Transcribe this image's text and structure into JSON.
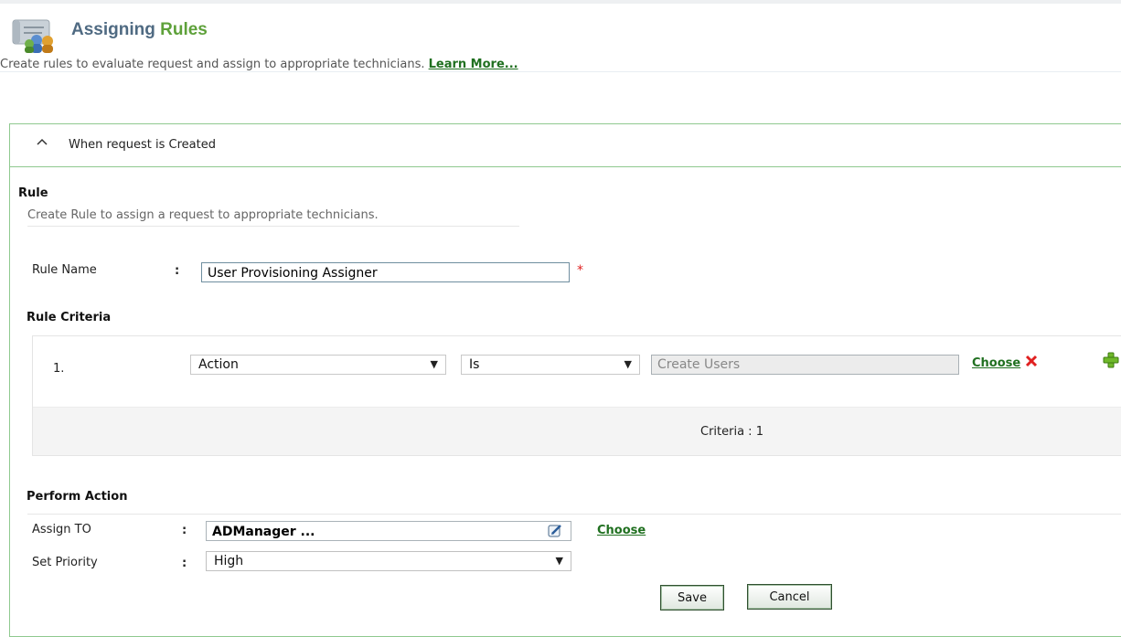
{
  "header": {
    "title_part1": "Assigning ",
    "title_part2": "Rules",
    "subtitle": "Create rules to evaluate request and assign to appropriate technicians. ",
    "learn_more": "Learn More...",
    "icon": "scroll-users-icon"
  },
  "panel": {
    "title": "When request is Created",
    "collapse_icon": "chevron-up-icon"
  },
  "rule": {
    "section_label": "Rule",
    "description": "Create Rule to assign a request to appropriate technicians.",
    "name_label": "Rule Name",
    "colon": ":",
    "name_value": "User Provisioning Assigner",
    "required_mark": "*"
  },
  "criteria": {
    "section_label": "Rule Criteria",
    "rows": [
      {
        "index": "1.",
        "field": "Action",
        "operator": "Is",
        "value_placeholder": "Create Users",
        "choose_label": "Choose"
      }
    ],
    "count_text": "Criteria : 1"
  },
  "perform_action": {
    "section_label": "Perform Action",
    "assign_label": "Assign TO",
    "assign_value": "ADManager ...",
    "assign_choose": "Choose",
    "priority_label": "Set Priority",
    "priority_value": "High"
  },
  "buttons": {
    "save": "Save",
    "cancel": "Cancel"
  },
  "colors": {
    "accent_green": "#5ea13a",
    "link_green": "#207020",
    "title_blue": "#4f6a82",
    "panel_border": "#8fc98f",
    "delete_red": "#e02020"
  }
}
